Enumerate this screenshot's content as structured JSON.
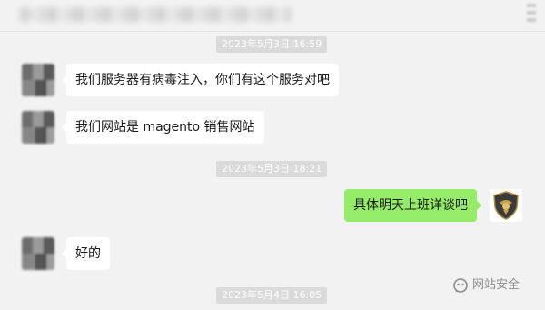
{
  "header": {
    "title_blurred": true
  },
  "timestamps": [
    "2023年5月3日 16:59",
    "2023年5月3日 18:21",
    "2023年5月4日 16:05"
  ],
  "messages": [
    {
      "from": "contact",
      "text": "我们服务器有病毒注入，你们有这个服务对吧"
    },
    {
      "from": "contact",
      "text": "我们网站是  magento 销售网站"
    },
    {
      "from": "me",
      "text": "具体明天上班详谈吧"
    },
    {
      "from": "contact",
      "text": "好的"
    }
  ],
  "watermark": {
    "text": "网站安全",
    "icon": "wechat-official-account-icon"
  },
  "colors": {
    "background": "#f2f2f2",
    "incoming_bubble": "#ffffff",
    "outgoing_bubble": "#95ec69",
    "timestamp_bg": "#dadada"
  }
}
